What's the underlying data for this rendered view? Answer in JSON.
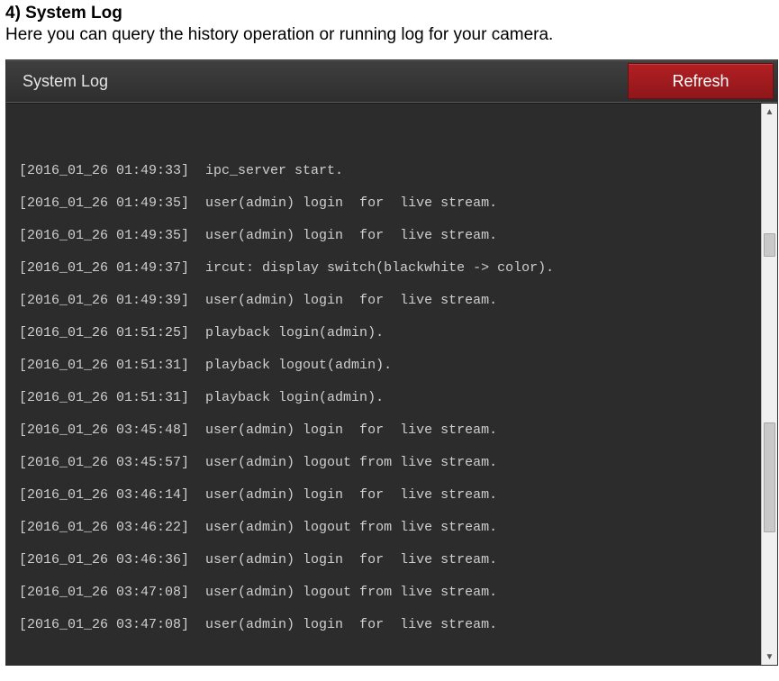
{
  "doc": {
    "heading": "4) System Log",
    "description": "Here you can query the history operation or running log for your camera."
  },
  "header": {
    "title": "System Log",
    "refresh_label": "Refresh"
  },
  "log": {
    "entries": [
      "[2016_01_26 01:49:33]  ipc_server start.",
      "[2016_01_26 01:49:35]  user(admin) login  for  live stream.",
      "[2016_01_26 01:49:35]  user(admin) login  for  live stream.",
      "[2016_01_26 01:49:37]  ircut: display switch(blackwhite -> color).",
      "[2016_01_26 01:49:39]  user(admin) login  for  live stream.",
      "[2016_01_26 01:51:25]  playback login(admin).",
      "[2016_01_26 01:51:31]  playback logout(admin).",
      "[2016_01_26 01:51:31]  playback login(admin).",
      "[2016_01_26 03:45:48]  user(admin) login  for  live stream.",
      "[2016_01_26 03:45:57]  user(admin) logout from live stream.",
      "[2016_01_26 03:46:14]  user(admin) login  for  live stream.",
      "[2016_01_26 03:46:22]  user(admin) logout from live stream.",
      "[2016_01_26 03:46:36]  user(admin) login  for  live stream.",
      "[2016_01_26 03:47:08]  user(admin) logout from live stream.",
      "[2016_01_26 03:47:08]  user(admin) login  for  live stream."
    ]
  },
  "colors": {
    "panel_bg": "#2c2c2c",
    "titlebar_bg": "#353535",
    "refresh_bg": "#a11b1e",
    "text_log": "#cfcfcf"
  }
}
